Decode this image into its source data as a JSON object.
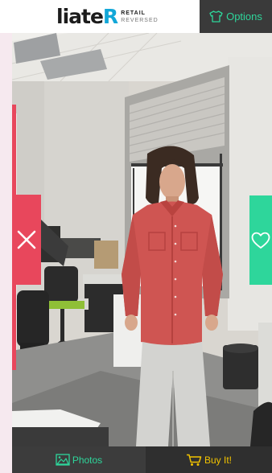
{
  "header": {
    "logo_main_dark": "liate",
    "logo_main_accent": "R",
    "logo_sub_top": "RETAIL",
    "logo_sub_bottom": "REVERSED",
    "options_label": "Options",
    "options_icon": "shirt-icon"
  },
  "actions": {
    "dislike_icon": "close-icon",
    "like_icon": "heart-icon"
  },
  "bottom_bar": {
    "photos_label": "Photos",
    "photos_icon": "image-icon",
    "buy_label": "Buy It!",
    "buy_icon": "cart-icon"
  },
  "colors": {
    "accent_green": "#2ed69b",
    "dislike_red": "#e8475c",
    "buy_yellow": "#f2c300",
    "logo_blue": "#12a7d8"
  }
}
